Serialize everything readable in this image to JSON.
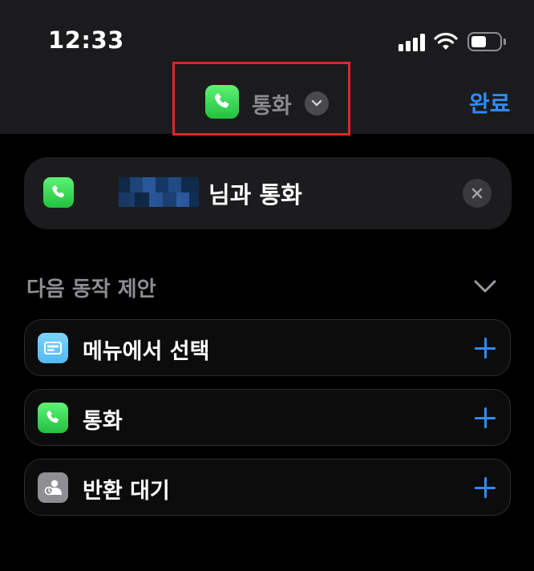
{
  "status_bar": {
    "time": "12:33"
  },
  "nav": {
    "title": "통화",
    "done_label": "완료"
  },
  "action": {
    "text": "님과 통화"
  },
  "suggestions": {
    "title": "다음 동작 제안",
    "items": [
      {
        "label": "메뉴에서 선택",
        "icon": "menu-select-icon"
      },
      {
        "label": "통화",
        "icon": "phone-icon"
      },
      {
        "label": "반환 대기",
        "icon": "wait-to-return-icon"
      }
    ]
  },
  "colors": {
    "accent": "#2f8cf6",
    "highlight_border": "#e0252b",
    "phone_green": "#34c759"
  }
}
